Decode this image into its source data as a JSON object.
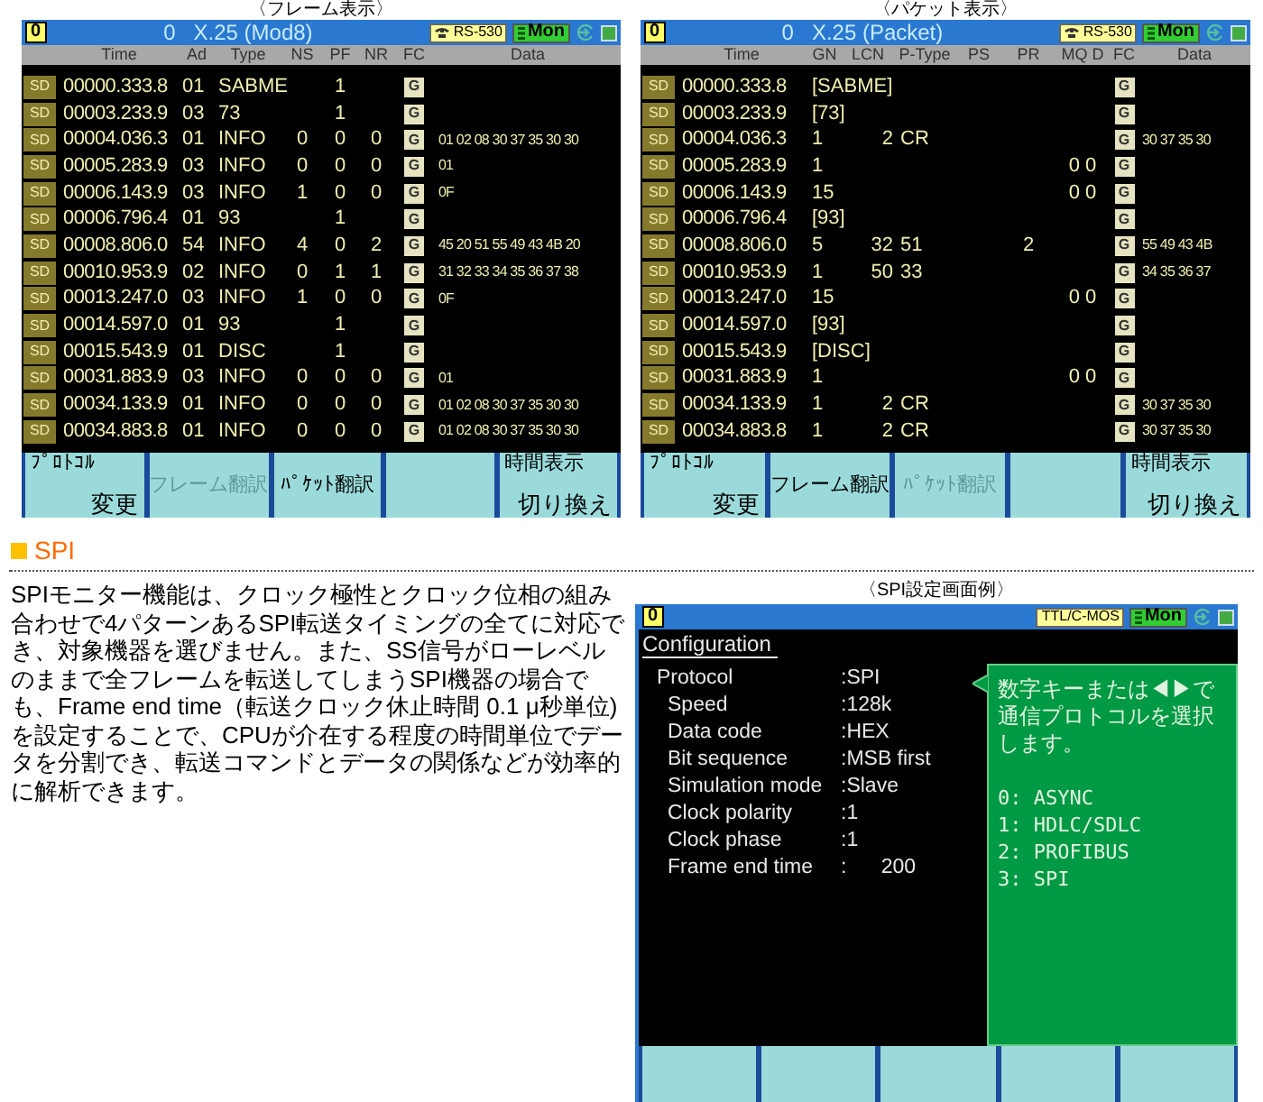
{
  "screens": [
    {
      "kind": "frame",
      "caption": "〈フレーム表示〉",
      "port": "0",
      "channel": "0",
      "title": "X.25 (Mod8)",
      "interface": "RS-530",
      "mode": "Mon",
      "columns": [
        "Time",
        "Ad",
        "Type",
        "NS",
        "PF",
        "NR",
        "FC",
        "Data"
      ],
      "rows": [
        {
          "dir": "SD",
          "time": "00000.333.8",
          "ad": "01",
          "type": "SABME",
          "pf": "1",
          "fc": "G"
        },
        {
          "dir": "SD",
          "time": "00003.233.9",
          "ad": "03",
          "type": "73",
          "pf": "1",
          "fc": "G"
        },
        {
          "dir": "SD",
          "time": "00004.036.3",
          "ad": "01",
          "type": "INFO",
          "ns": "0",
          "pf": "0",
          "nr": "0",
          "fc": "G",
          "data": "01 02 08 30 37 35 30 30"
        },
        {
          "dir": "SD",
          "time": "00005.283.9",
          "ad": "03",
          "type": "INFO",
          "ns": "0",
          "pf": "0",
          "nr": "0",
          "fc": "G",
          "data": "01"
        },
        {
          "dir": "SD",
          "time": "00006.143.9",
          "ad": "03",
          "type": "INFO",
          "ns": "1",
          "pf": "0",
          "nr": "0",
          "fc": "G",
          "data": "0F"
        },
        {
          "dir": "SD",
          "time": "00006.796.4",
          "ad": "01",
          "type": "93",
          "pf": "1",
          "fc": "G"
        },
        {
          "dir": "SD",
          "time": "00008.806.0",
          "ad": "54",
          "type": "INFO",
          "ns": "4",
          "pf": "0",
          "nr": "2",
          "fc": "G",
          "data": "45 20 51 55 49 43 4B 20"
        },
        {
          "dir": "SD",
          "time": "00010.953.9",
          "ad": "02",
          "type": "INFO",
          "ns": "0",
          "pf": "1",
          "nr": "1",
          "fc": "G",
          "data": "31 32 33 34 35 36 37 38"
        },
        {
          "dir": "SD",
          "time": "00013.247.0",
          "ad": "03",
          "type": "INFO",
          "ns": "1",
          "pf": "0",
          "nr": "0",
          "fc": "G",
          "data": "0F"
        },
        {
          "dir": "SD",
          "time": "00014.597.0",
          "ad": "01",
          "type": "93",
          "pf": "1",
          "fc": "G"
        },
        {
          "dir": "SD",
          "time": "00015.543.9",
          "ad": "01",
          "type": "DISC",
          "pf": "1",
          "fc": "G"
        },
        {
          "dir": "SD",
          "time": "00031.883.9",
          "ad": "03",
          "type": "INFO",
          "ns": "0",
          "pf": "0",
          "nr": "0",
          "fc": "G",
          "data": "01"
        },
        {
          "dir": "SD",
          "time": "00034.133.9",
          "ad": "01",
          "type": "INFO",
          "ns": "0",
          "pf": "0",
          "nr": "0",
          "fc": "G",
          "data": "01 02 08 30 37 35 30 30"
        },
        {
          "dir": "SD",
          "time": "00034.883.8",
          "ad": "01",
          "type": "INFO",
          "ns": "0",
          "pf": "0",
          "nr": "0",
          "fc": "G",
          "data": "01 02 08 30 37 35 30 30"
        }
      ],
      "softkeys": [
        {
          "kind": "two_line",
          "top": "ﾌﾟﾛﾄｺﾙ",
          "bottom": "変更",
          "disabled": false
        },
        {
          "kind": "one_line",
          "label": "フレーム翻訳",
          "disabled": true
        },
        {
          "kind": "one_line",
          "label": "ﾊﾟｹｯﾄ翻訳",
          "disabled": false
        },
        {
          "kind": "blank"
        },
        {
          "kind": "two_line",
          "top": "時間表示",
          "bottom": "切り換え",
          "disabled": false
        }
      ]
    },
    {
      "kind": "packet",
      "caption": "〈パケット表示〉",
      "port": "0",
      "channel": "0",
      "title": "X.25 (Packet)",
      "interface": "RS-530",
      "mode": "Mon",
      "columns": [
        "Time",
        "GN",
        "LCN",
        "P-Type",
        "PS",
        "PR",
        "MQ D",
        "FC",
        "Data"
      ],
      "rows": [
        {
          "dir": "SD",
          "time": "00000.333.8",
          "gn": "[SABME]",
          "fc": "G"
        },
        {
          "dir": "SD",
          "time": "00003.233.9",
          "gn": "[73]",
          "fc": "G"
        },
        {
          "dir": "SD",
          "time": "00004.036.3",
          "gn": "1",
          "lcn": "2",
          "ptype": "CR",
          "fc": "G",
          "data": "30 37 35 30"
        },
        {
          "dir": "SD",
          "time": "00005.283.9",
          "gn": "1",
          "mqd": "0 0",
          "fc": "G"
        },
        {
          "dir": "SD",
          "time": "00006.143.9",
          "gn": "15",
          "mqd": "0 0",
          "fc": "G"
        },
        {
          "dir": "SD",
          "time": "00006.796.4",
          "gn": "[93]",
          "fc": "G"
        },
        {
          "dir": "SD",
          "time": "00008.806.0",
          "gn": "5",
          "lcn": "32",
          "ptype": "51",
          "pr": "2",
          "fc": "G",
          "data": "55 49 43 4B"
        },
        {
          "dir": "SD",
          "time": "00010.953.9",
          "gn": "1",
          "lcn": "50",
          "ptype": "33",
          "fc": "G",
          "data": "34 35 36 37"
        },
        {
          "dir": "SD",
          "time": "00013.247.0",
          "gn": "15",
          "mqd": "0 0",
          "fc": "G"
        },
        {
          "dir": "SD",
          "time": "00014.597.0",
          "gn": "[93]",
          "fc": "G"
        },
        {
          "dir": "SD",
          "time": "00015.543.9",
          "gn": "[DISC]",
          "fc": "G"
        },
        {
          "dir": "SD",
          "time": "00031.883.9",
          "gn": "1",
          "mqd": "0 0",
          "fc": "G"
        },
        {
          "dir": "SD",
          "time": "00034.133.9",
          "gn": "1",
          "lcn": "2",
          "ptype": "CR",
          "fc": "G",
          "data": "30 37 35 30"
        },
        {
          "dir": "SD",
          "time": "00034.883.8",
          "gn": "1",
          "lcn": "2",
          "ptype": "CR",
          "fc": "G",
          "data": "30 37 35 30"
        }
      ],
      "softkeys": [
        {
          "kind": "two_line",
          "top": "ﾌﾟﾛﾄｺﾙ",
          "bottom": "変更",
          "disabled": false
        },
        {
          "kind": "one_line",
          "label": "フレーム翻訳",
          "disabled": false
        },
        {
          "kind": "one_line",
          "label": "ﾊﾟｹｯﾄ翻訳",
          "disabled": true
        },
        {
          "kind": "blank"
        },
        {
          "kind": "two_line",
          "top": "時間表示",
          "bottom": "切り換え",
          "disabled": false
        }
      ]
    }
  ],
  "section": {
    "heading": "SPI",
    "paragraph": "SPIモニター機能は、クロック極性とクロック位相の組み合わせで4パターンあるSPI転送タイミングの全てに対応でき、対象機器を選びません。また、SS信号がローレベルのままで全フレームを転送してしまうSPI機器の場合でも、Frame end time（転送クロック休止時間 0.1 μ秒単位)を設定することで、CPUが介在する程度の時間単位でデータを分割でき、転送コマンドとデータの関係などが効率的に解析できます。"
  },
  "config_screen": {
    "caption": "〈SPI設定画面例〉",
    "port": "0",
    "interface": "TTL/C-MOS",
    "mode": "Mon",
    "heading": "Configuration",
    "settings": [
      {
        "label": "Protocol",
        "value": ":SPI",
        "children": [
          {
            "label": "Speed",
            "value": ":128k"
          },
          {
            "label": "Data code",
            "value": ":HEX"
          },
          {
            "label": "Bit sequence",
            "value": ":MSB first"
          },
          {
            "label": "Simulation mode",
            "value": ":Slave"
          },
          {
            "label": "Clock polarity",
            "value": ":1"
          },
          {
            "label": "Clock phase",
            "value": ":1"
          },
          {
            "label": "Frame end time",
            "value": ":      200"
          }
        ]
      }
    ],
    "help_lines": [
      "数字キーまたは◀▶で",
      "通信プロトコルを選択",
      "します。"
    ],
    "options": [
      "0: ASYNC",
      "1: HDLC/SDLC",
      "2: PROFIBUS",
      "3: SPI"
    ],
    "softkeys": [
      {
        "kind": "blank"
      },
      {
        "kind": "blank"
      },
      {
        "kind": "blank"
      },
      {
        "kind": "blank"
      },
      {
        "kind": "blank"
      }
    ]
  }
}
